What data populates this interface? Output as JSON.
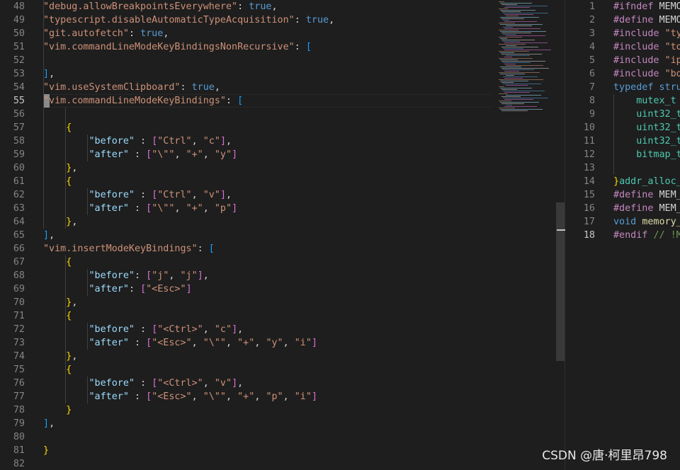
{
  "left_editor": {
    "lines": [
      {
        "n": "48",
        "segs": [
          [
            "str",
            "\"debug.allowBreakpointsEverywhere\""
          ],
          [
            "p",
            ": "
          ],
          [
            "kw",
            "true"
          ],
          [
            "p",
            ","
          ]
        ]
      },
      {
        "n": "49",
        "segs": [
          [
            "str",
            "\"typescript.disableAutomaticTypeAcquisition\""
          ],
          [
            "p",
            ": "
          ],
          [
            "kw",
            "true"
          ],
          [
            "p",
            ","
          ]
        ]
      },
      {
        "n": "50",
        "segs": [
          [
            "str",
            "\"git.autofetch\""
          ],
          [
            "p",
            ": "
          ],
          [
            "kw",
            "true"
          ],
          [
            "p",
            ","
          ]
        ]
      },
      {
        "n": "51",
        "segs": [
          [
            "str",
            "\"vim.commandLineModeKeyBindingsNonRecursive\""
          ],
          [
            "p",
            ": "
          ],
          [
            "b3",
            "["
          ]
        ]
      },
      {
        "n": "52",
        "segs": []
      },
      {
        "n": "53",
        "segs": [
          [
            "b3",
            "]"
          ],
          [
            "p",
            ","
          ]
        ]
      },
      {
        "n": "54",
        "segs": [
          [
            "str",
            "\"vim.useSystemClipboard\""
          ],
          [
            "p",
            ": "
          ],
          [
            "kw",
            "true"
          ],
          [
            "p",
            ","
          ]
        ]
      },
      {
        "n": "55",
        "active": true,
        "segs": [
          [
            "str",
            "\"vim.commandLineModeKeyBindings\""
          ],
          [
            "p",
            ": "
          ],
          [
            "b3",
            "["
          ]
        ]
      },
      {
        "n": "56",
        "segs": []
      },
      {
        "n": "57",
        "segs": [
          [
            "p",
            "    "
          ],
          [
            "b1",
            "{"
          ]
        ]
      },
      {
        "n": "58",
        "segs": [
          [
            "p",
            "        "
          ],
          [
            "key",
            "\"before\""
          ],
          [
            "p",
            " : "
          ],
          [
            "b2",
            "["
          ],
          [
            "str",
            "\"Ctrl\""
          ],
          [
            "p",
            ", "
          ],
          [
            "str",
            "\"c\""
          ],
          [
            "b2",
            "]"
          ],
          [
            "p",
            ","
          ]
        ]
      },
      {
        "n": "59",
        "segs": [
          [
            "p",
            "        "
          ],
          [
            "key",
            "\"after\""
          ],
          [
            "p",
            " : "
          ],
          [
            "b2",
            "["
          ],
          [
            "str",
            "\"\\\"\""
          ],
          [
            "p",
            ", "
          ],
          [
            "str",
            "\"+\""
          ],
          [
            "p",
            ", "
          ],
          [
            "str",
            "\"y\""
          ],
          [
            "b2",
            "]"
          ]
        ]
      },
      {
        "n": "60",
        "segs": [
          [
            "p",
            "    "
          ],
          [
            "b1",
            "}"
          ],
          [
            "p",
            ","
          ]
        ]
      },
      {
        "n": "61",
        "segs": [
          [
            "p",
            "    "
          ],
          [
            "b1",
            "{"
          ]
        ]
      },
      {
        "n": "62",
        "segs": [
          [
            "p",
            "        "
          ],
          [
            "key",
            "\"before\""
          ],
          [
            "p",
            " : "
          ],
          [
            "b2",
            "["
          ],
          [
            "str",
            "\"Ctrl\""
          ],
          [
            "p",
            ", "
          ],
          [
            "str",
            "\"v\""
          ],
          [
            "b2",
            "]"
          ],
          [
            "p",
            ","
          ]
        ]
      },
      {
        "n": "63",
        "segs": [
          [
            "p",
            "        "
          ],
          [
            "key",
            "\"after\""
          ],
          [
            "p",
            " : "
          ],
          [
            "b2",
            "["
          ],
          [
            "str",
            "\"\\\"\""
          ],
          [
            "p",
            ", "
          ],
          [
            "str",
            "\"+\""
          ],
          [
            "p",
            ", "
          ],
          [
            "str",
            "\"p\""
          ],
          [
            "b2",
            "]"
          ]
        ]
      },
      {
        "n": "64",
        "segs": [
          [
            "p",
            "    "
          ],
          [
            "b1",
            "}"
          ],
          [
            "p",
            ","
          ]
        ]
      },
      {
        "n": "65",
        "segs": [
          [
            "b3",
            "]"
          ],
          [
            "p",
            ","
          ]
        ]
      },
      {
        "n": "66",
        "segs": [
          [
            "str",
            "\"vim.insertModeKeyBindings\""
          ],
          [
            "p",
            ": "
          ],
          [
            "b3",
            "["
          ]
        ]
      },
      {
        "n": "67",
        "segs": [
          [
            "p",
            "    "
          ],
          [
            "b1",
            "{"
          ]
        ]
      },
      {
        "n": "68",
        "segs": [
          [
            "p",
            "        "
          ],
          [
            "key",
            "\"before\""
          ],
          [
            "p",
            ": "
          ],
          [
            "b2",
            "["
          ],
          [
            "str",
            "\"j\""
          ],
          [
            "p",
            ", "
          ],
          [
            "str",
            "\"j\""
          ],
          [
            "b2",
            "]"
          ],
          [
            "p",
            ","
          ]
        ]
      },
      {
        "n": "69",
        "segs": [
          [
            "p",
            "        "
          ],
          [
            "key",
            "\"after\""
          ],
          [
            "p",
            ": "
          ],
          [
            "b2",
            "["
          ],
          [
            "str",
            "\"<Esc>\""
          ],
          [
            "b2",
            "]"
          ]
        ]
      },
      {
        "n": "70",
        "segs": [
          [
            "p",
            "    "
          ],
          [
            "b1",
            "}"
          ],
          [
            "p",
            ","
          ]
        ]
      },
      {
        "n": "71",
        "segs": [
          [
            "p",
            "    "
          ],
          [
            "b1",
            "{"
          ]
        ]
      },
      {
        "n": "72",
        "segs": [
          [
            "p",
            "        "
          ],
          [
            "key",
            "\"before\""
          ],
          [
            "p",
            " : "
          ],
          [
            "b2",
            "["
          ],
          [
            "str",
            "\"<Ctrl>\""
          ],
          [
            "p",
            ", "
          ],
          [
            "str",
            "\"c\""
          ],
          [
            "b2",
            "]"
          ],
          [
            "p",
            ","
          ]
        ]
      },
      {
        "n": "73",
        "segs": [
          [
            "p",
            "        "
          ],
          [
            "key",
            "\"after\""
          ],
          [
            "p",
            " : "
          ],
          [
            "b2",
            "["
          ],
          [
            "str",
            "\"<Esc>\""
          ],
          [
            "p",
            ", "
          ],
          [
            "str",
            "\"\\\"\""
          ],
          [
            "p",
            ", "
          ],
          [
            "str",
            "\"+\""
          ],
          [
            "p",
            ", "
          ],
          [
            "str",
            "\"y\""
          ],
          [
            "p",
            ", "
          ],
          [
            "str",
            "\"i\""
          ],
          [
            "b2",
            "]"
          ]
        ]
      },
      {
        "n": "74",
        "segs": [
          [
            "p",
            "    "
          ],
          [
            "b1",
            "}"
          ],
          [
            "p",
            ","
          ]
        ]
      },
      {
        "n": "75",
        "segs": [
          [
            "p",
            "    "
          ],
          [
            "b1",
            "{"
          ]
        ]
      },
      {
        "n": "76",
        "segs": [
          [
            "p",
            "        "
          ],
          [
            "key",
            "\"before\""
          ],
          [
            "p",
            " : "
          ],
          [
            "b2",
            "["
          ],
          [
            "str",
            "\"<Ctrl>\""
          ],
          [
            "p",
            ", "
          ],
          [
            "str",
            "\"v\""
          ],
          [
            "b2",
            "]"
          ],
          [
            "p",
            ","
          ]
        ]
      },
      {
        "n": "77",
        "segs": [
          [
            "p",
            "        "
          ],
          [
            "key",
            "\"after\""
          ],
          [
            "p",
            " : "
          ],
          [
            "b2",
            "["
          ],
          [
            "str",
            "\"<Esc>\""
          ],
          [
            "p",
            ", "
          ],
          [
            "str",
            "\"\\\"\""
          ],
          [
            "p",
            ", "
          ],
          [
            "str",
            "\"+\""
          ],
          [
            "p",
            ", "
          ],
          [
            "str",
            "\"p\""
          ],
          [
            "p",
            ", "
          ],
          [
            "str",
            "\"i\""
          ],
          [
            "b2",
            "]"
          ]
        ]
      },
      {
        "n": "78",
        "segs": [
          [
            "p",
            "    "
          ],
          [
            "b1",
            "}"
          ]
        ]
      },
      {
        "n": "79",
        "segs": [
          [
            "b3",
            "]"
          ],
          [
            "p",
            ","
          ]
        ]
      },
      {
        "n": "80",
        "segs": []
      },
      {
        "n": "81",
        "segs": [
          [
            "b1",
            "}"
          ]
        ]
      },
      {
        "n": "82",
        "segs": []
      }
    ]
  },
  "right_editor": {
    "lines": [
      {
        "n": "1",
        "segs": [
          [
            "pre",
            "#ifndef "
          ],
          [
            "p",
            "MEMO"
          ]
        ]
      },
      {
        "n": "2",
        "segs": [
          [
            "pre",
            "#define "
          ],
          [
            "p",
            "MEMO"
          ]
        ]
      },
      {
        "n": "3",
        "segs": [
          [
            "pre",
            "#include "
          ],
          [
            "str",
            "\"typ"
          ]
        ]
      },
      {
        "n": "4",
        "segs": [
          [
            "pre",
            "#include "
          ],
          [
            "str",
            "\"too"
          ]
        ]
      },
      {
        "n": "5",
        "segs": [
          [
            "pre",
            "#include "
          ],
          [
            "str",
            "\"ipc"
          ]
        ]
      },
      {
        "n": "6",
        "segs": [
          [
            "pre",
            "#include "
          ],
          [
            "str",
            "\"boo"
          ]
        ]
      },
      {
        "n": "7",
        "segs": [
          [
            "kw",
            "typedef "
          ],
          [
            "kw",
            "struc"
          ]
        ]
      },
      {
        "n": "8",
        "segs": [
          [
            "p",
            "    "
          ],
          [
            "typ",
            "mutex_t"
          ],
          [
            "p",
            " m"
          ]
        ]
      },
      {
        "n": "9",
        "segs": [
          [
            "p",
            "    "
          ],
          [
            "typ",
            "uint32_t"
          ]
        ]
      },
      {
        "n": "10",
        "segs": [
          [
            "p",
            "    "
          ],
          [
            "typ",
            "uint32_t"
          ]
        ]
      },
      {
        "n": "11",
        "segs": [
          [
            "p",
            "    "
          ],
          [
            "typ",
            "uint32_t"
          ]
        ]
      },
      {
        "n": "12",
        "segs": [
          [
            "p",
            "    "
          ],
          [
            "typ",
            "bitmap_t"
          ]
        ]
      },
      {
        "n": "13",
        "segs": []
      },
      {
        "n": "14",
        "segs": [
          [
            "b1",
            "}"
          ],
          [
            "typ",
            "addr_alloc_t"
          ]
        ]
      },
      {
        "n": "15",
        "segs": [
          [
            "pre",
            "#define "
          ],
          [
            "p",
            "MEM_"
          ]
        ]
      },
      {
        "n": "16",
        "segs": [
          [
            "pre",
            "#define "
          ],
          [
            "p",
            "MEM_"
          ]
        ]
      },
      {
        "n": "17",
        "segs": [
          [
            "kw",
            "void "
          ],
          [
            "fn",
            "memory_"
          ]
        ]
      },
      {
        "n": "18",
        "active": true,
        "segs": [
          [
            "pre",
            "#endif "
          ],
          [
            "cmt",
            "// !MEM"
          ]
        ]
      }
    ]
  },
  "colors": {
    "background": "#1e1e1e",
    "string": "#ce9178",
    "property": "#9cdcfe",
    "keyword": "#569cd6",
    "bracket_level1": "#ffd700",
    "bracket_level2": "#da70d6",
    "bracket_level3": "#179fff"
  },
  "watermark": "CSDN @唐·柯里昂798"
}
